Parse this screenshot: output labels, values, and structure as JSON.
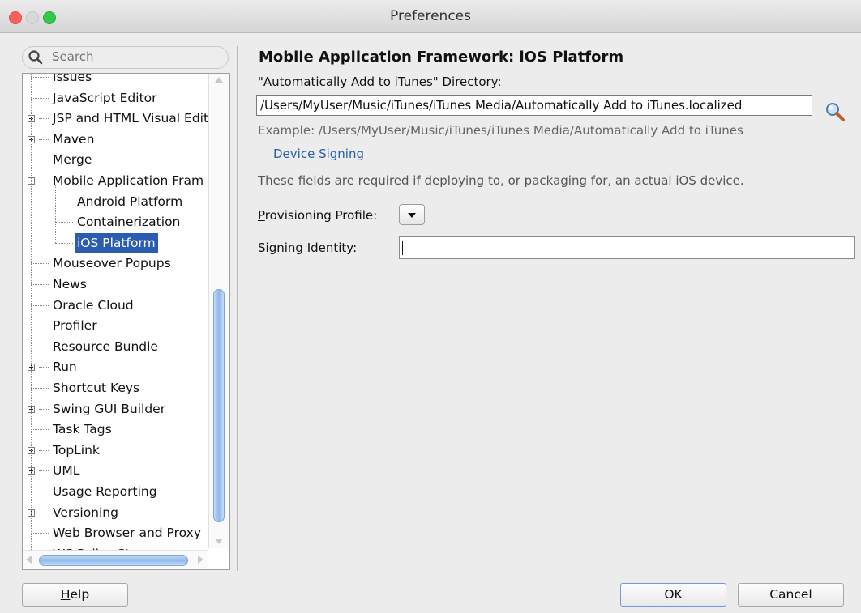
{
  "window": {
    "title": "Preferences"
  },
  "search": {
    "placeholder": "Search"
  },
  "tree": {
    "items": [
      {
        "label": "Issues",
        "level": 1,
        "expander": "none",
        "partial": "top"
      },
      {
        "label": "JavaScript Editor",
        "level": 1,
        "expander": "none"
      },
      {
        "label": "JSP and HTML Visual Edit",
        "level": 1,
        "expander": "plus"
      },
      {
        "label": "Maven",
        "level": 1,
        "expander": "plus"
      },
      {
        "label": "Merge",
        "level": 1,
        "expander": "none"
      },
      {
        "label": "Mobile Application Fram",
        "level": 1,
        "expander": "minus"
      },
      {
        "label": "Android Platform",
        "level": 2,
        "expander": "none"
      },
      {
        "label": "Containerization",
        "level": 2,
        "expander": "none"
      },
      {
        "label": "iOS Platform",
        "level": 2,
        "expander": "none",
        "selected": true
      },
      {
        "label": "Mouseover Popups",
        "level": 1,
        "expander": "none"
      },
      {
        "label": "News",
        "level": 1,
        "expander": "none"
      },
      {
        "label": "Oracle Cloud",
        "level": 1,
        "expander": "none"
      },
      {
        "label": "Profiler",
        "level": 1,
        "expander": "none"
      },
      {
        "label": "Resource Bundle",
        "level": 1,
        "expander": "none"
      },
      {
        "label": "Run",
        "level": 1,
        "expander": "plus"
      },
      {
        "label": "Shortcut Keys",
        "level": 1,
        "expander": "none"
      },
      {
        "label": "Swing GUI Builder",
        "level": 1,
        "expander": "plus"
      },
      {
        "label": "Task Tags",
        "level": 1,
        "expander": "none"
      },
      {
        "label": "TopLink",
        "level": 1,
        "expander": "plus"
      },
      {
        "label": "UML",
        "level": 1,
        "expander": "plus"
      },
      {
        "label": "Usage Reporting",
        "level": 1,
        "expander": "none"
      },
      {
        "label": "Versioning",
        "level": 1,
        "expander": "plus"
      },
      {
        "label": "Web Browser and Proxy",
        "level": 1,
        "expander": "none"
      },
      {
        "label": "WS Policy Store",
        "level": 1,
        "expander": "none",
        "partial": "bottom"
      }
    ]
  },
  "panel": {
    "title": "Mobile Application Framework: iOS Platform",
    "dir_label_pre": "\"Automatically Add to ",
    "dir_label_mnemonic": "i",
    "dir_label_post": "Tunes\" Directory:",
    "dir_value": "/Users/MyUser/Music/iTunes/iTunes Media/Automatically Add to iTunes.localized",
    "example": "Example: /Users/MyUser/Music/iTunes/iTunes Media/Automatically Add to iTunes",
    "section_title": "Device Signing",
    "note": "These fields are required if deploying to, or packaging for, an actual iOS device.",
    "prov_mnemonic": "P",
    "prov_rest": "rovisioning Profile:",
    "sign_mnemonic": "S",
    "sign_rest": "igning Identity:",
    "sign_value": ""
  },
  "buttons": {
    "help_mnemonic": "H",
    "help_rest": "elp",
    "ok": "OK",
    "cancel": "Cancel"
  },
  "colors": {
    "selection": "#2a5db0",
    "section_title": "#2b5ea8",
    "thumb": "#8fb8ea"
  }
}
